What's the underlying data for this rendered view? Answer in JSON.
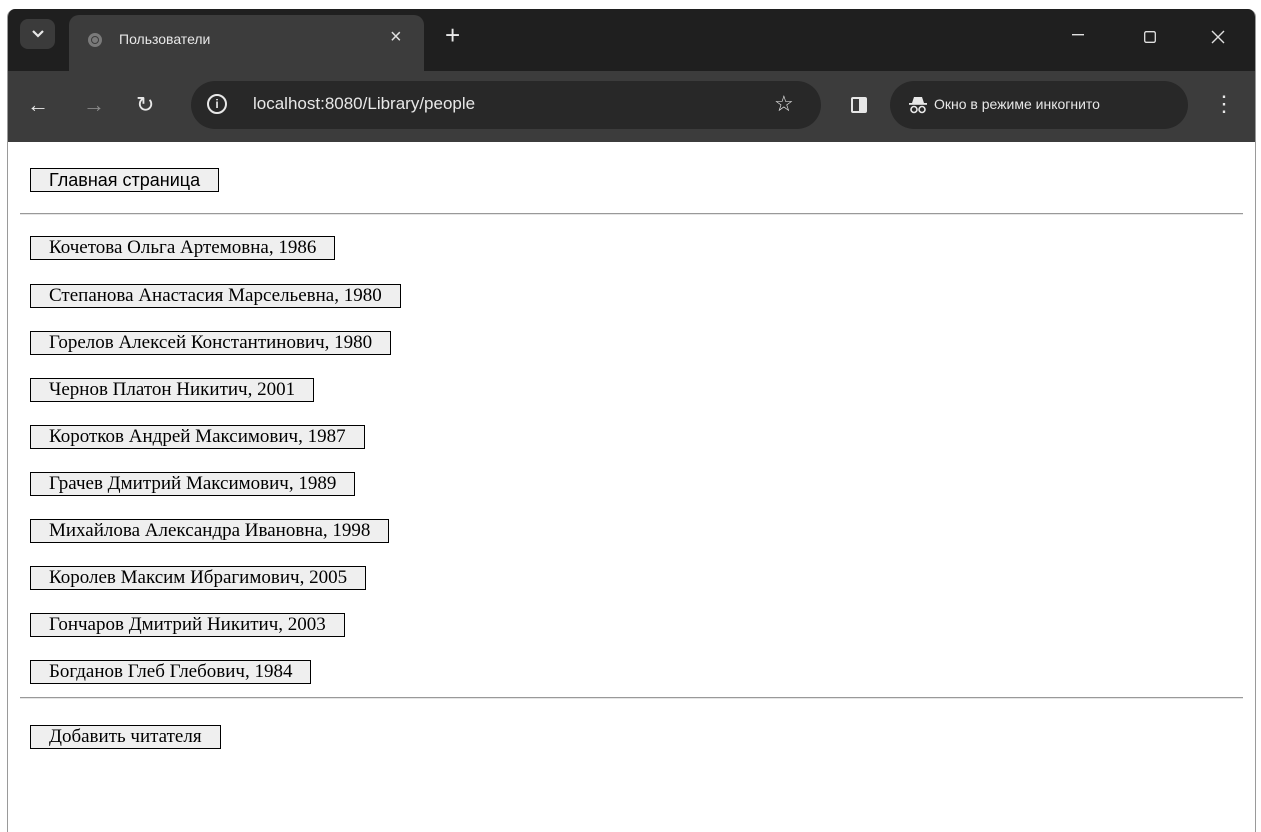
{
  "tab": {
    "title": "Пользователи"
  },
  "toolbar": {
    "url": "localhost:8080/Library/people",
    "incognito_label": "Окно в режиме инкогнито"
  },
  "page": {
    "home_button": "Главная страница",
    "people": [
      "Кочетова Ольга Артемовна, 1986",
      "Степанова Анастасия Марсельевна, 1980",
      "Горелов Алексей Константинович, 1980",
      "Чернов Платон Никитич, 2001",
      "Коротков Андрей Максимович, 1987",
      "Грачев Дмитрий Максимович, 1989",
      "Михайлова Александра Ивановна, 1998",
      "Королев Максим Ибрагимович, 2005",
      "Гончаров Дмитрий Никитич, 2003",
      "Богданов Глеб Глебович, 1984"
    ],
    "add_button": "Добавить читателя"
  },
  "icons": {
    "tab_search": "chevron-down-icon",
    "favicon": "globe-icon",
    "tab_close": "close-icon",
    "new_tab": "plus-icon",
    "back": "arrow-left-icon",
    "forward": "arrow-right-icon",
    "reload": "reload-icon",
    "site_info": "info-icon",
    "bookmark": "star-icon",
    "side_panel": "side-panel-icon",
    "incognito": "incognito-icon",
    "menu": "kebab-menu-icon"
  }
}
